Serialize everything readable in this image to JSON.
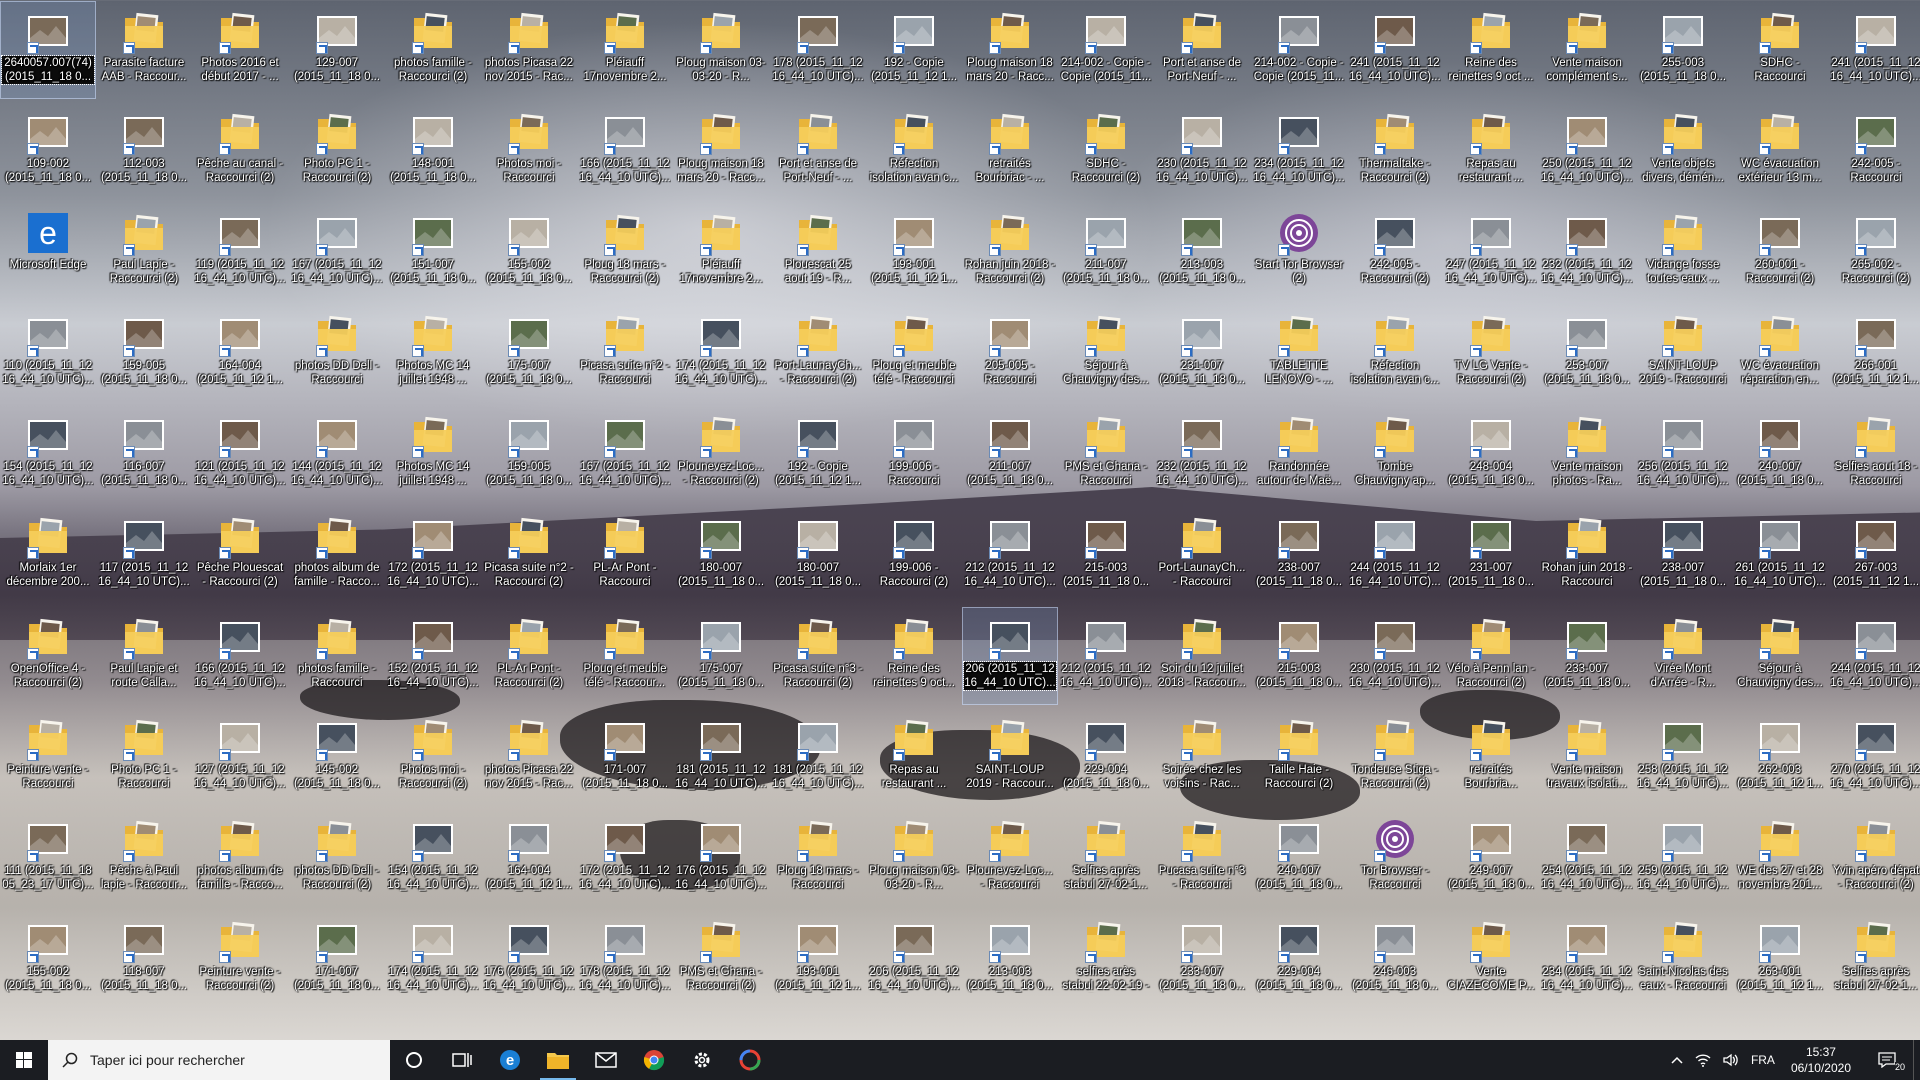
{
  "desktop": {
    "columns": [
      [
        "2640057.007(74)\n(2015_11_18 0...",
        "109-002 (2015_11_18 0...",
        "Microsoft Edge",
        "110 (2015_11_12 16_44_10 UTC)...",
        "154 (2015_11_12 16_44_10 UTC)...",
        "Morlaix 1er décembre 200...",
        "OpenOffice 4 - Raccourci (2)",
        "Peinture vente - Raccourci",
        "111 (2015_11_18 05_23_17 UTC)...",
        "155-002 (2015_11_18 0..."
      ],
      [
        "Parasite facture AAB - Raccour...",
        "112-003 (2015_11_18 0...",
        "Paul Lapie - Raccourci (2)",
        "159-005 (2015_11_18 0...",
        "116-007 (2015_11_18 0...",
        "117 (2015_11_12 16_44_10 UTC)...",
        "Paul Lapie et route Calla...",
        "Photo PC 1 - Raccourci",
        "Pêche à Paul lapie - Raccour...",
        "118-007 (2015_11_18 0..."
      ],
      [
        "Photos 2016 et début 2017 - ...",
        "Pêche au canal - Raccourci (2)",
        "119 (2015_11_12 16_44_10 UTC)...",
        "164-004 (2015_11_12 1...",
        "121 (2015_11_12 16_44_10 UTC)...",
        "Pêche Plouescat - Raccourci (2)",
        "166 (2015_11_12 16_44_10 UTC)...",
        "127 (2015_11_12 16_44_10 UTC)...",
        "photos album de famille - Racco...",
        "Peinture vente - Raccourci (2)"
      ],
      [
        "129-007 (2015_11_18 0...",
        "Photo PC 1 - Raccourci (2)",
        "167 (2015_11_12 16_44_10 UTC)...",
        "photos DD Dell - Raccourci",
        "144 (2015_11_12 16_44_10 UTC)...",
        "photos album de famille - Racco...",
        "photos famille - Raccourci",
        "145-002 (2015_11_18 0...",
        "photos DD Dell - Raccourci (2)",
        "171-007 (2015_11_18 0..."
      ],
      [
        "photos famille - Raccourci (2)",
        "148-001 (2015_11_18 0...",
        "151-007 (2015_11_18 0...",
        "Photos MC 14 juillet 1948 ...",
        "Photos MC 14 juillet 1948 ...",
        "172 (2015_11_12 16_44_10 UTC)...",
        "152 (2015_11_12 16_44_10 UTC)...",
        "Photos moi - Raccourci (2)",
        "154 (2015_11_12 16_44_10 UTC)...",
        "174 (2015_11_12 16_44_10 UTC)..."
      ],
      [
        "photos Picasa 22 nov 2015 - Rac...",
        "Photos moi - Raccourci",
        "155-002 (2015_11_18 0...",
        "175-007 (2015_11_18 0...",
        "159-005 (2015_11_18 0...",
        "Picasa suite n°2 - Raccourci (2)",
        "PL-Ar Pont - Raccourci (2)",
        "photos Picasa 22 nov 2015 - Rac...",
        "164-004 (2015_11_12 1...",
        "176 (2015_11_12 16_44_10 UTC)..."
      ],
      [
        "Pléiauff 17novembre 2...",
        "166 (2015_11_12 16_44_10 UTC)...",
        "Ploug 18 mars - Raccourci (2)",
        "Picasa suite n°2 - Raccourci",
        "167 (2015_11_12 16_44_10 UTC)...",
        "PL-Ar Pont - Raccourci",
        "Ploug et meuble télé - Raccour...",
        "171-007 (2015_11_18 0...",
        "172 (2015_11_12 16_44_10 UTC)...",
        "178 (2015_11_12 16_44_10 UTC)..."
      ],
      [
        "Ploug maison 03-03-20 - R...",
        "Ploug maison 18 mars 20 - Racc...",
        "Pléiauff 17novembre 2...",
        "174 (2015_11_12 16_44_10 UTC)...",
        "Plounevez-Loc... - Raccourci (2)",
        "180-007 (2015_11_18 0...",
        "175-007 (2015_11_18 0...",
        "181 (2015_11_12 16_44_10 UTC)...",
        "176 (2015_11_12 16_44_10 UTC)...",
        "PMS et Ghana - Raccourci (2)"
      ],
      [
        "178 (2015_11_12 16_44_10 UTC)...",
        "Port et anse de Port-Neuf - ...",
        "Plouescat 25 aout 19 - R...",
        "Port-LaunayCh... - Raccourci (2)",
        "192 - Copie (2015_11_12 1...",
        "180-007 (2015_11_18 0...",
        "Picasa suite n°3 - Raccourci (2)",
        "181 (2015_11_12 16_44_10 UTC)...",
        "Ploug 18 mars - Raccourci",
        "193-001 (2015_11_12 1..."
      ],
      [
        "192 - Copie (2015_11_12 1...",
        "Réfection isolation avan c...",
        "193-001 (2015_11_12 1...",
        "Ploug et meuble télé - Raccourci",
        "199-006 - Raccourci",
        "199-006 - Raccourci (2)",
        "Reine des reinettes 9 oct...",
        "Repas au restaurant ...",
        "Ploug maison 03-03-20 - R...",
        "206 (2015_11_12 16_44_10 UTC)..."
      ],
      [
        "Ploug maison 18 mars 20 - Racc...",
        "retraités Bourbriac - ...",
        "Rohan juin 2018 - Raccourci (2)",
        "205-005 - Raccourci",
        "211-007 (2015_11_18 0...",
        "212 (2015_11_12 16_44_10 UTC)...",
        "206 (2015_11_12 16_44_10 UTC)...",
        "SAINT-LOUP 2019 - Raccour...",
        "Plounevez-Loc... - Raccourci",
        "213-003 (2015_11_18 0..."
      ],
      [
        "214-002 - Copie - Copie (2015_11...",
        "SDHC - Raccourci (2)",
        "211-007 (2015_11_18 0...",
        "Séjour à Chauvigny des...",
        "PMS et Ghana - Raccourci",
        "215-003 (2015_11_18 0...",
        "212 (2015_11_12 16_44_10 UTC)...",
        "229-004 (2015_11_18 0...",
        "Selfies après stabul 27-02-1...",
        "selfies arès stabul 22-02-19 - Racc..."
      ],
      [
        "Port et anse de Port-Neuf - ...",
        "230 (2015_11_12 16_44_10 UTC)...",
        "213-003 (2015_11_18 0...",
        "231-007 (2015_11_18 0...",
        "232 (2015_11_12 16_44_10 UTC)...",
        "Port-LaunayCh... - Raccourci",
        "Soir du 12 juillet 2018 - Raccour...",
        "Soirée chez les voisins - Rac...",
        "Pucasa suite n°3 - Raccourci",
        "233-007 (2015_11_18 0..."
      ],
      [
        "214-002 - Copie - Copie (2015_11...",
        "234 (2015_11_12 16_44_10 UTC)...",
        "Start Tor Browser (2)",
        "TABLETTE LENOVO - ...",
        "Randonnée autour de Maë...",
        "238-007 (2015_11_18 0...",
        "215-003 (2015_11_18 0...",
        "Taille Haie - Raccourci (2)",
        "240-007 (2015_11_18 0...",
        "229-004 (2015_11_18 0..."
      ],
      [
        "241 (2015_11_12 16_44_10 UTC)...",
        "Thermaltake - Raccourci (2)",
        "242-005 - Raccourci (2)",
        "Réfection isolation avan c...",
        "Tombe Chauvigny ap...",
        "244 (2015_11_12 16_44_10 UTC)...",
        "230 (2015_11_12 16_44_10 UTC)...",
        "Tondeuse Stiga - Raccourci (2)",
        "Tor Browser - Raccourci",
        "246-003 (2015_11_18 0..."
      ],
      [
        "Reine des reinettes 9 oct ...",
        "Repas au restaurant ...",
        "247 (2015_11_12 16_44_10 UTC)...",
        "TV LG Vente - Raccourci (2)",
        "248-004 (2015_11_18 0...",
        "231-007 (2015_11_18 0...",
        "Vélo à Penn lan - Raccourci (2)",
        "retraités Bourbria...",
        "249-007 (2015_11_18 0...",
        "Vente CIAZECOME P..."
      ],
      [
        "Vente maison complément s...",
        "250 (2015_11_12 16_44_10 UTC)...",
        "232 (2015_11_12 16_44_10 UTC)...",
        "253-007 (2015_11_18 0...",
        "Vente maison photos - Ra...",
        "Rohan juin 2018 - Raccourci",
        "233-007 (2015_11_18 0...",
        "Vente maison travaux isolati...",
        "254 (2015_11_12 16_44_10 UTC)...",
        "234 (2015_11_12 16_44_10 UTC)..."
      ],
      [
        "255-003 (2015_11_18 0...",
        "Vente objets divers, démén...",
        "Vidange fosse toutes eaux ...",
        "SAINT-LOUP 2019 - Raccourci",
        "256 (2015_11_12 16_44_10 UTC)...",
        "238-007 (2015_11_18 0...",
        "Virée Mont d'Arrée - R...",
        "258 (2015_11_12 16_44_10 UTC)...",
        "259 (2015_11_12 16_44_10 UTC)...",
        "Saint-Nicolas des eaux - Raccourci"
      ],
      [
        "SDHC - Raccourci",
        "WC évacuation extérieur 13 m...",
        "260-001 - Raccourci (2)",
        "WC évacuation réparation en...",
        "240-007 (2015_11_18 0...",
        "261 (2015_11_12 16_44_10 UTC)...",
        "Séjour à Chauvigny des...",
        "262-003 (2015_11_12 1...",
        "WE des 27 et 28 novembre 201...",
        "263-001 (2015_11_12 1..."
      ],
      [
        "241 (2015_11_12 16_44_10 UTC)...",
        "242-005 - Raccourci",
        "265-002 - Raccourci (2)",
        "266-001 (2015_11_12 1...",
        "Selfies aout 18 - Raccourci",
        "267-003 (2015_11_12 1...",
        "244 (2015_11_12 16_44_10 UTC)...",
        "270 (2015_11_12 16_44_10 UTC)...",
        "Yvin apéro dépat - Raccourci (2)",
        "Selfies après stabul 27-02-1..."
      ]
    ]
  },
  "taskbar": {
    "search_placeholder": "Taper ici pour rechercher",
    "language": "FRA",
    "time": "15:37",
    "date": "06/10/2020",
    "notification_count": "20"
  }
}
